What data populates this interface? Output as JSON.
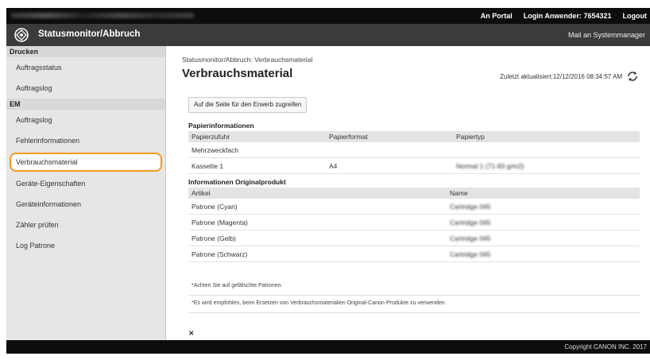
{
  "topbar": {
    "portal_link": "An Portal",
    "login_label": "Login Anwender:",
    "login_user": "7654321",
    "logout": "Logout"
  },
  "header": {
    "title": "Statusmonitor/Abbruch",
    "mail_link": "Mail an Systemmanager"
  },
  "sidebar": {
    "groups": [
      {
        "title": "Drucken",
        "items": [
          {
            "label": "Auftragsstatus"
          },
          {
            "label": "Auftragslog"
          }
        ]
      },
      {
        "title": "EM",
        "items": [
          {
            "label": "Auftragslog"
          },
          {
            "label": "Fehlerinformationen"
          },
          {
            "label": "Verbrauchsmaterial"
          },
          {
            "label": "Geräte-Eigenschaften"
          },
          {
            "label": "Geräteinformationen"
          },
          {
            "label": "Zähler prüfen"
          },
          {
            "label": "Log Patrone"
          }
        ]
      }
    ]
  },
  "main": {
    "breadcrumb": "Statusmonitor/Abbruch: Verbrauchsmaterial",
    "title": "Verbrauchsmaterial",
    "updated": "Zuletzt aktualisiert:12/12/2016 08:34:57 AM",
    "purchase_button": "Auf die Seite für den Erwerb zugreifen",
    "paper": {
      "title": "Papierinformationen",
      "headers": [
        "Papierzufuhr",
        "Papierformat",
        "Papiertyp"
      ],
      "rows": [
        {
          "source": "Mehrzweckfach",
          "format": "",
          "type": ""
        },
        {
          "source": "Kassette 1",
          "format": "A4",
          "type": "Normal 1 (71-83 g/m2)"
        }
      ]
    },
    "original": {
      "title": "Informationen Originalprodukt",
      "headers": [
        "Artikel",
        "Name"
      ],
      "rows": [
        {
          "article": "Patrone (Cyan)",
          "name": "Cartridge 045"
        },
        {
          "article": "Patrone (Magenta)",
          "name": "Cartridge 045"
        },
        {
          "article": "Patrone (Gelb)",
          "name": "Cartridge 045"
        },
        {
          "article": "Patrone (Schwarz)",
          "name": "Cartridge 045"
        }
      ]
    },
    "notes": [
      "*Achten Sie auf gefälschte Patronen.",
      "*Es wird empfohlen, beim Ersetzen von Verbrauchsmaterialien Original-Canon-Produkte zu verwenden."
    ],
    "to_top_symbol": "⨯"
  },
  "footer": {
    "copyright": "Copyright CANON INC. 2017"
  },
  "colors": {
    "highlight": "#f29b1d",
    "topbar": "#0d0d0d",
    "header": "#3b3b3b",
    "sidebar": "#e6e6e6"
  }
}
